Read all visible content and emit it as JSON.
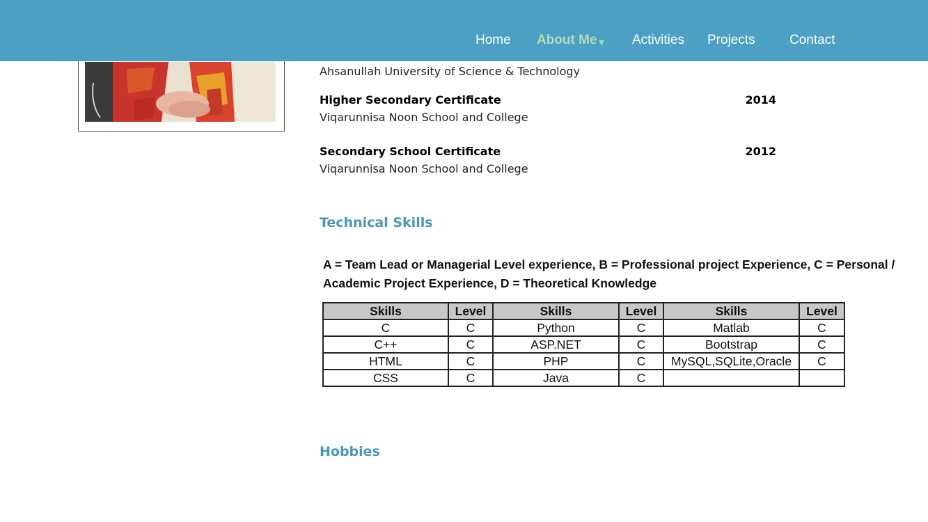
{
  "nav": {
    "items": [
      {
        "label": "Home"
      },
      {
        "label": "About Me"
      },
      {
        "label": "Activities"
      },
      {
        "label": "Projects"
      },
      {
        "label": "Contact"
      }
    ],
    "active_caret": "▾"
  },
  "education": {
    "university": "Ahsanullah University of Science & Technology",
    "entries": [
      {
        "title": "Higher Secondary Certificate",
        "year": "2014",
        "institution": "Viqarunnisa Noon School and College"
      },
      {
        "title": "Secondary School Certificate",
        "year": "2012",
        "institution": "Viqarunnisa Noon School and College"
      }
    ]
  },
  "technical_skills": {
    "heading": "Technical Skills",
    "legend": "A = Team Lead or Managerial Level experience, B = Professional project Experience, C = Personal / Academic Project Experience, D = Theoretical Knowledge",
    "headers": [
      "Skills",
      "Level",
      "Skills",
      "Level",
      "Skills",
      "Level"
    ],
    "rows": [
      [
        "C",
        "C",
        "Python",
        "C",
        "Matlab",
        "C"
      ],
      [
        "C++",
        "C",
        "ASP.NET",
        "C",
        "Bootstrap",
        "C"
      ],
      [
        "HTML",
        "C",
        "PHP",
        "C",
        "MySQL,SQLite,Oracle",
        "C"
      ],
      [
        "CSS",
        "C",
        "Java",
        "C",
        "",
        ""
      ]
    ]
  },
  "hobbies": {
    "heading": "Hobbies"
  },
  "colors": {
    "navbar": "#4ba0c4",
    "nav_active": "#b5d9b4",
    "heading": "#4a96b8",
    "table_header": "#c8c8c8"
  }
}
